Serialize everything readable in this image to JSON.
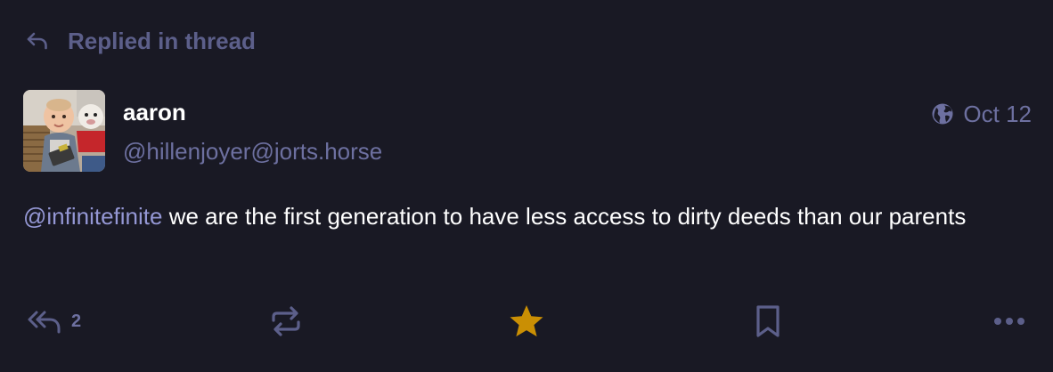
{
  "prepend": {
    "icon": "reply-icon",
    "label": "Replied in thread"
  },
  "account": {
    "display_name": "aaron",
    "acct": "@hillenjoyer@jorts.horse",
    "avatar": "avatar"
  },
  "meta": {
    "visibility_icon": "globe-icon",
    "date": "Oct 12"
  },
  "content": {
    "mention": "@infinitefinite",
    "text": " we are the first generation to have less access to dirty deeds than our parents"
  },
  "actions": {
    "reply_count": "2",
    "favourite_color": "#ca8f04",
    "icon_color": "#5c5f8a"
  }
}
